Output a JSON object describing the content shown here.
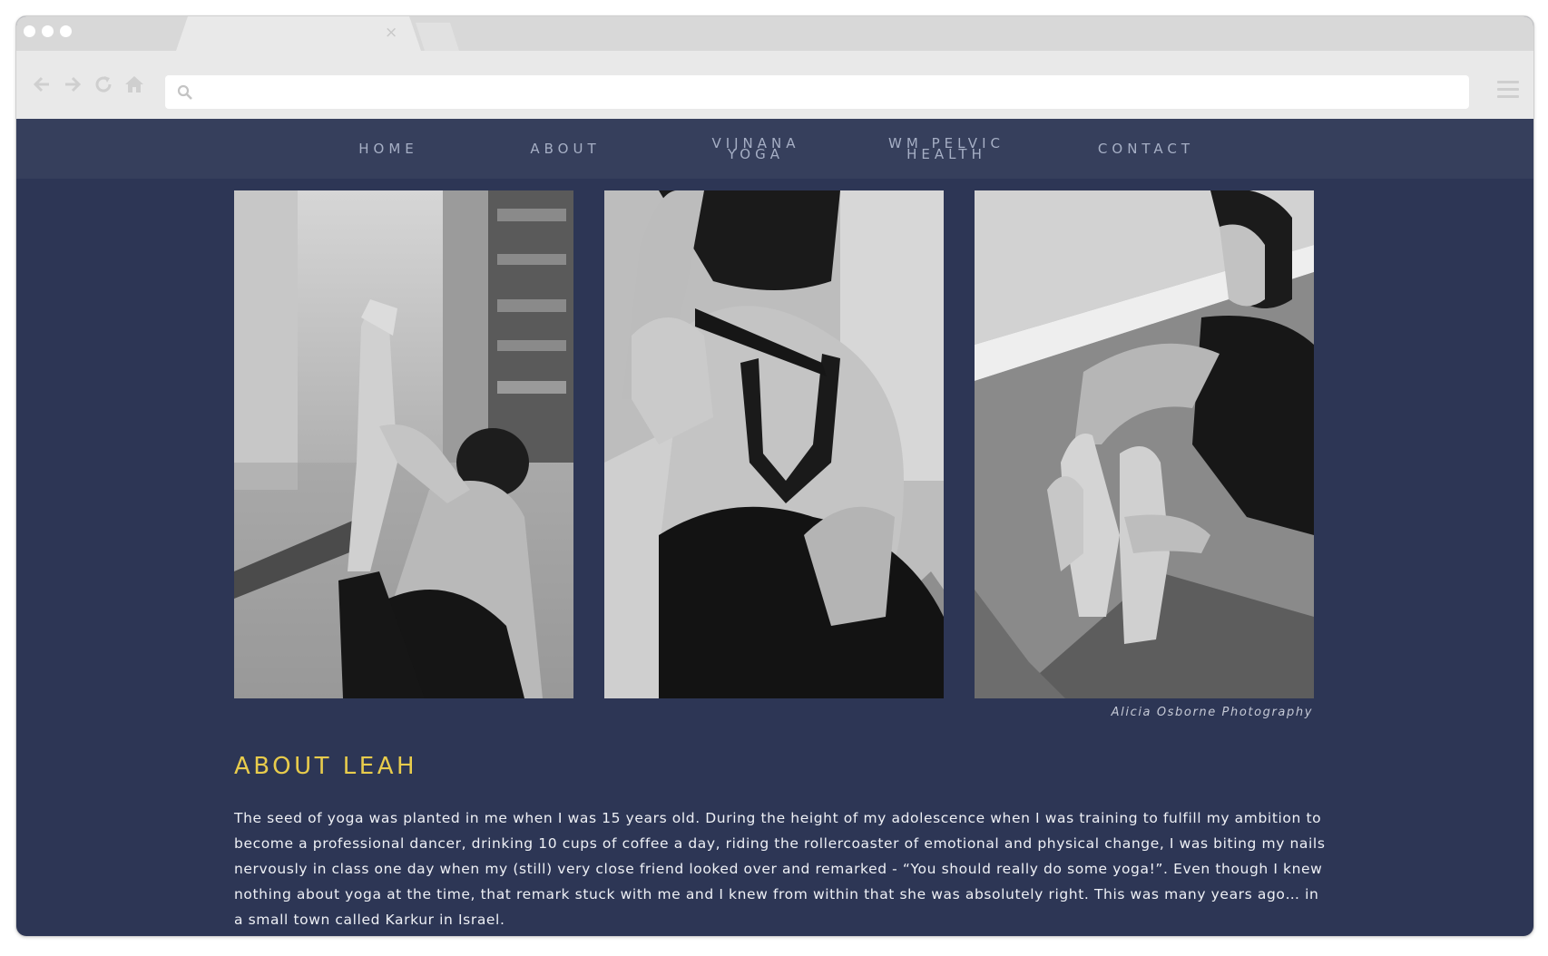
{
  "browser": {
    "icons": {
      "back": "back-arrow-icon",
      "forward": "forward-arrow-icon",
      "reload": "reload-icon",
      "home": "home-icon",
      "search": "search-icon",
      "menu": "hamburger-menu-icon",
      "tab_close": "close-icon"
    },
    "address_value": "",
    "tab_close_glyph": "×"
  },
  "site": {
    "nav": [
      {
        "line1": "HOME",
        "line2": ""
      },
      {
        "line1": "ABOUT",
        "line2": ""
      },
      {
        "line1": "VIJNANA",
        "line2": "YOGA"
      },
      {
        "line1": "WM PELVIC",
        "line2": "HEALTH"
      },
      {
        "line1": "CONTACT",
        "line2": ""
      }
    ],
    "photos": [
      {
        "alt": "black-and-white photo of a woman in a seated yoga stretch holding one raised foot"
      },
      {
        "alt": "black-and-white photo of a woman's back with hands clasped behind in a yoga bind"
      },
      {
        "alt": "black-and-white photo of a woman in a seated forward fold holding the soles of her feet"
      }
    ],
    "photo_credit": "Alicia Osborne Photography",
    "heading": "ABOUT LEAH",
    "bio": "The seed of yoga was planted in me when I was 15 years old. During the height of my adolescence when I was training to fulfill my ambition to become a professional dancer, drinking 10 cups of coffee a day, riding the rollercoaster of emotional and physical change, I was biting my nails nervously in class one day when my (still) very close friend looked over and remarked - “You should really do some yoga!”. Even though I knew nothing about yoga at the time, that remark stuck with me and I knew from within that she was absolutely right. This was many years ago… in a small town called Karkur in Israel.",
    "colors": {
      "nav_bg": "#363f5c",
      "page_bg": "#2d3655",
      "nav_text": "#a6afc5",
      "heading": "#e8cc4c",
      "body_text": "#eef0f5"
    }
  }
}
